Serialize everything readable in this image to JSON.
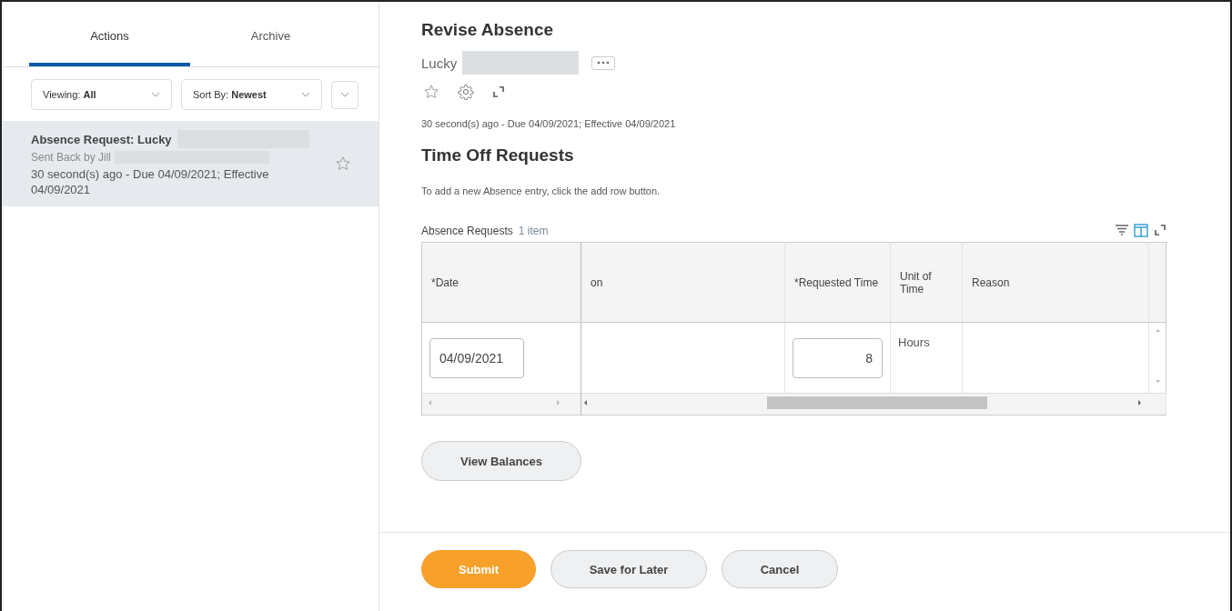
{
  "sidebar": {
    "tabs": [
      {
        "label": "Actions",
        "selected": true
      },
      {
        "label": "Archive",
        "selected": false
      }
    ],
    "filters": [
      {
        "text": "Viewing: **All**"
      },
      {
        "text": "Sort By: **Newest**"
      }
    ],
    "items": [
      {
        "title": "Absence Request: Lucky",
        "subtitle": "Sent Back by Jill",
        "meta": "30 second(s) ago - Due 04/09/2021; Effective 04/09/2021",
        "selected": true,
        "starred": false
      }
    ]
  },
  "main": {
    "title": "Revise Absence",
    "worker": "Lucky",
    "meta": "30 second(s) ago - Due 04/09/2021; Effective 04/09/2021",
    "section_title": "Time Off Requests",
    "instruction": "To add a new Absence entry, click the add row button.",
    "grid": {
      "title": "Absence Requests",
      "count": "1 item",
      "columns": [
        "*Date",
        "on",
        "*Requested Time",
        "Unit of Time",
        "Reason"
      ],
      "rows": [
        {
          "date": "04/09/2021",
          "requested_time": "8",
          "unit_of_time": "Hours"
        }
      ]
    },
    "buttons": [
      {
        "label": "View Balances"
      }
    ]
  },
  "footer": {
    "buttons": [
      {
        "label": "Submit",
        "kind": "primary"
      },
      {
        "label": "Save for Later",
        "kind": "secondary"
      },
      {
        "label": "Cancel",
        "kind": "secondary"
      }
    ]
  }
}
